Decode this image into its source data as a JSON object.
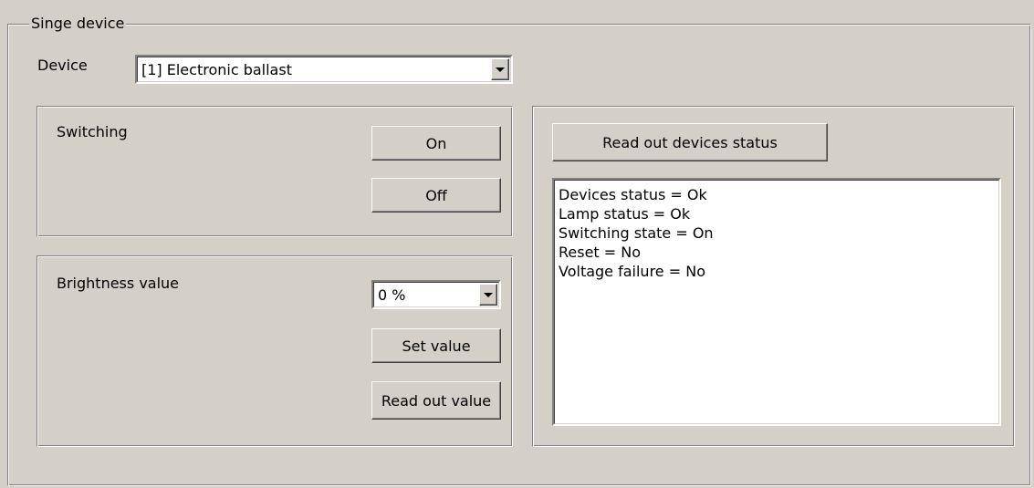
{
  "group": {
    "title": "Singe device"
  },
  "device": {
    "label": "Device",
    "selected": "[1] Electronic ballast"
  },
  "switching": {
    "label": "Switching",
    "on_button": "On",
    "off_button": "Off"
  },
  "brightness": {
    "label": "Brightness value",
    "selected": "0 %",
    "set_button": "Set value",
    "read_button": "Read out value"
  },
  "status": {
    "read_button": "Read out devices status",
    "lines": [
      "Devices status = Ok",
      "Lamp status = Ok",
      "Switching state = On",
      "Reset = No",
      "Voltage failure = No"
    ]
  }
}
